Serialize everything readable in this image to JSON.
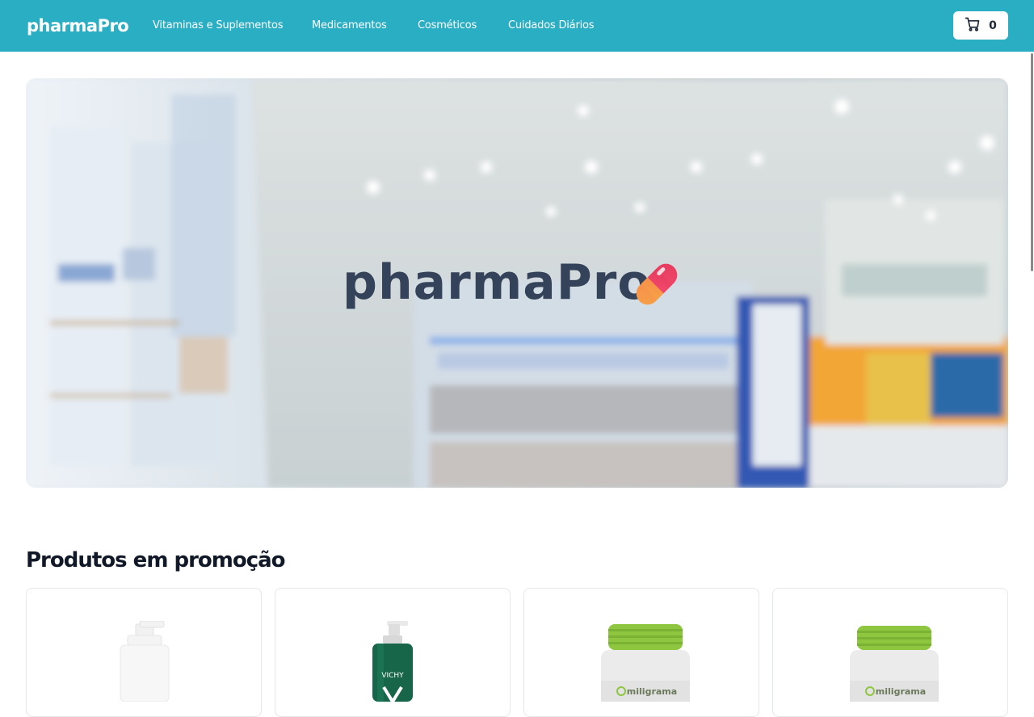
{
  "header": {
    "logo": "pharmaPro",
    "nav": [
      {
        "label": "Vitaminas e Suplementos"
      },
      {
        "label": "Medicamentos"
      },
      {
        "label": "Cosméticos"
      },
      {
        "label": "Cuidados Diários"
      }
    ],
    "cart": {
      "count": "0",
      "icon": "shopping-cart-icon"
    }
  },
  "hero": {
    "title": "pharmaPro",
    "icon": "pill-capsule-icon",
    "background": "pharmacy-shelves-blurred-photo"
  },
  "promotions": {
    "title": "Produtos em promoção",
    "products": [
      {
        "image": "foam-pump-bottle-white"
      },
      {
        "image": "vichy-green-pump-bottle",
        "brand": "VICHY"
      },
      {
        "image": "miligrama-supplement-jar",
        "brand": "miligrama"
      },
      {
        "image": "miligrama-supplement-jar",
        "brand": "miligrama"
      }
    ]
  },
  "colors": {
    "primary": "#2aaec4",
    "heroText": "#34435a",
    "pillOrange": "#f79a4a",
    "pillPink": "#f0486b"
  }
}
